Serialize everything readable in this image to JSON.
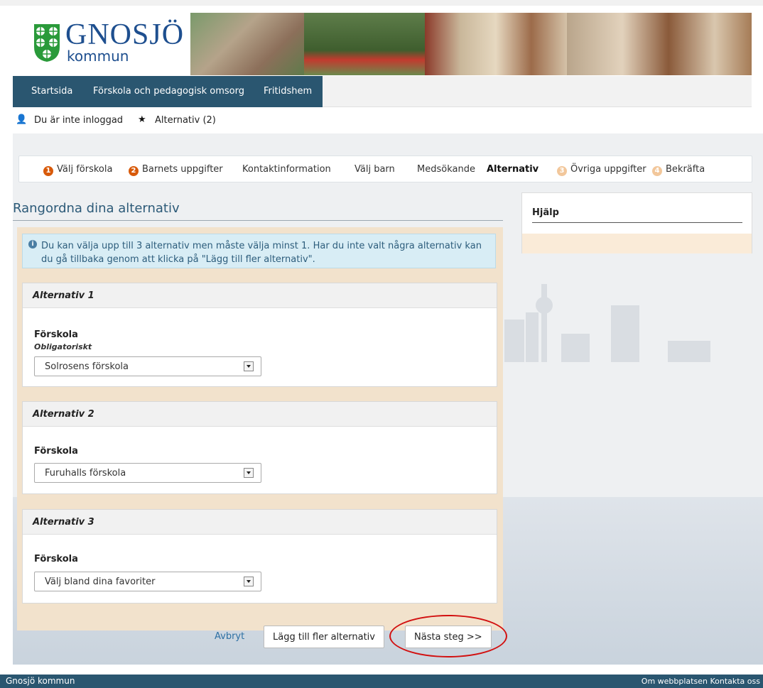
{
  "brand": {
    "name": "GNOSJÖ",
    "sub": "kommun"
  },
  "nav": {
    "items": [
      "Startsida",
      "Förskola och pedagogisk omsorg",
      "Fritidshem"
    ]
  },
  "user": {
    "status": "Du är inte inloggad",
    "favorites": "Alternativ (2)"
  },
  "steps": [
    {
      "n": "1",
      "label": "Välj förskola",
      "state": "done"
    },
    {
      "n": "2",
      "label": "Barnets uppgifter",
      "state": "done"
    },
    {
      "label": "Kontaktinformation"
    },
    {
      "label": "Välj barn"
    },
    {
      "label": "Medsökande"
    },
    {
      "label": "Alternativ",
      "state": "current"
    },
    {
      "n": "3",
      "label": "Övriga uppgifter",
      "state": "todo"
    },
    {
      "n": "4",
      "label": "Bekräfta",
      "state": "todo"
    }
  ],
  "main": {
    "title": "Rangordna dina alternativ",
    "info": "Du kan välja upp till 3 alternativ men måste välja minst 1. Har du inte valt några alternativ kan du gå tillbaka genom att klicka på \"Lägg till fler alternativ\".",
    "alternatives": [
      {
        "title": "Alternativ 1",
        "field_label": "Förskola",
        "required_text": "Obligatoriskt",
        "value": "Solrosens förskola"
      },
      {
        "title": "Alternativ 2",
        "field_label": "Förskola",
        "value": "Furuhalls förskola"
      },
      {
        "title": "Alternativ 3",
        "field_label": "Förskola",
        "value": "Välj bland dina favoriter"
      }
    ],
    "cancel": "Avbryt",
    "add_more": "Lägg till fler alternativ",
    "next": "Nästa steg >>"
  },
  "help": {
    "title": "Hjälp"
  },
  "footer": {
    "left": "Gnosjö kommun",
    "right": "Om webbplatsen  Kontakta oss"
  },
  "colors": {
    "nav": "#2a5670",
    "accent": "#d85a0a",
    "highlight": "#d21010"
  }
}
